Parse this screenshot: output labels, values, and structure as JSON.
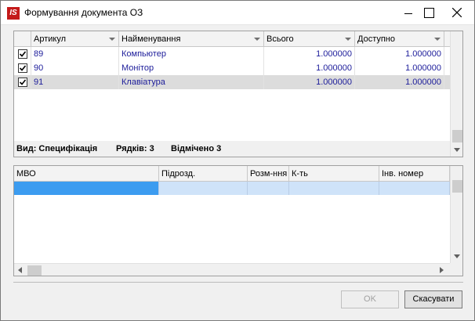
{
  "window": {
    "title": "Формування документа ОЗ",
    "logo_text": "IS"
  },
  "top_grid": {
    "columns": [
      "Артикул",
      "Найменування",
      "Всього",
      "Доступно"
    ],
    "rows": [
      {
        "article": "89",
        "name": "Компьютер",
        "total": "1.000000",
        "available": "1.000000",
        "checked": true
      },
      {
        "article": "90",
        "name": "Монітор",
        "total": "1.000000",
        "available": "1.000000",
        "checked": true
      },
      {
        "article": "91",
        "name": "Клавіатура",
        "total": "1.000000",
        "available": "1.000000",
        "checked": true
      }
    ],
    "status": {
      "view": "Вид: Специфікація",
      "rows": "Рядків: 3",
      "marked": "Відмічено 3"
    }
  },
  "bottom_grid": {
    "columns": [
      "МВО",
      "Підрозд.",
      "Розм-ння",
      "К-ть",
      "Інв. номер"
    ]
  },
  "buttons": {
    "ok": "OK",
    "cancel": "Скасувати"
  },
  "colors": {
    "accent_selection": "#3c9cf0",
    "row_text": "#1c1c9a",
    "logo_red": "#c41a1a"
  }
}
